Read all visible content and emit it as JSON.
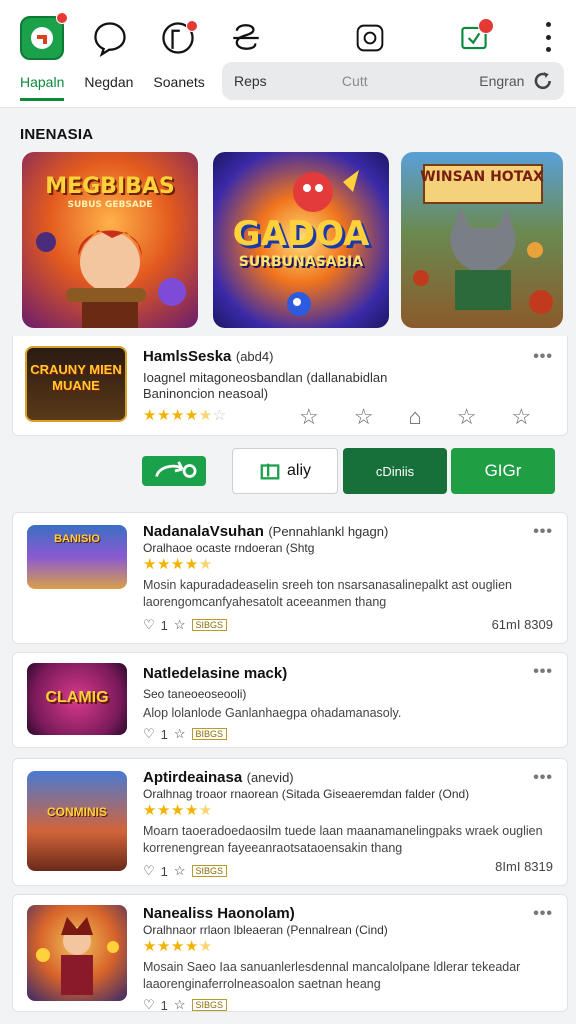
{
  "header": {
    "tabs": [
      {
        "label": "Hapaln",
        "active": true
      },
      {
        "label": "Negdan",
        "active": false
      },
      {
        "label": "Soanets",
        "active": false
      }
    ],
    "search": {
      "left": "Reps",
      "placeholder": "Cutt",
      "right": "Engran"
    }
  },
  "colors": {
    "accent": "#0b8a3c",
    "brand": "#1aa14a",
    "badge": "#e53935",
    "star": "#f2b300"
  },
  "featured": {
    "title": "INENASIA",
    "tiles": [
      {
        "title": "MEGBIBAS",
        "sub": "SUBUS GEBSADE"
      },
      {
        "title": "GADOA",
        "sub": "SURBUNASABIA"
      },
      {
        "title": "WINSAN HOTAX",
        "sub": ""
      }
    ]
  },
  "main_app": {
    "thumb_title": "CRAUNY MIEN MUANE",
    "name": "HamlsSeska",
    "name_suffix": "(abd4)",
    "line1": "Ioagnel mitagoneosbandlan (dallanabidlan",
    "line2": "Baninoncion neasoal)",
    "rating": 4.5
  },
  "actions": {
    "share_label": "",
    "play_label": "aliy",
    "collect_label": "cDiniis",
    "get_label": "GIGr"
  },
  "list": [
    {
      "name": "NadanalaVsuhan",
      "name_suffix": "(Pennahlankl hgagn)",
      "sub": "Oralhaoe ocaste rndoeran (Shtg",
      "rating": 4.5,
      "desc1": "Mosin kapuradadeaselin sreeh ton nsarsanasalinepalkt ast ouglien",
      "desc2": "laorengomcanfyahesatolt aceeanmen thang",
      "count": "1",
      "tag": "SIBGS",
      "size": "61mI 8309",
      "thumb_label": "BANISIO"
    },
    {
      "name": "Natledelasine mack)",
      "name_suffix": "",
      "sub": "Seo taneoeoseooli)",
      "rating": 0,
      "desc1": "Alop lolanlode Ganlanhaegpa ohadamanasoly.",
      "desc2": "",
      "count": "1",
      "tag": "BIBGS",
      "size": "",
      "thumb_label": "CLAMIG"
    },
    {
      "name": "Aptirdeainasa",
      "name_suffix": "(anevid)",
      "sub": "Oralhnag troaor rnaorean (Sitada Giseaeremdan falder (Ond)",
      "rating": 4.5,
      "desc1": "Moarn taoeradoedaosilm tuede laan maanamanelingpaks wraek ouglien",
      "desc2": "korrenengrean fayeeanraotsataoensakin thang",
      "count": "1",
      "tag": "SIBGS",
      "size": "8ImI 8319",
      "thumb_label": "CONMINIS"
    },
    {
      "name": "Nanealiss Haonolam)",
      "name_suffix": "",
      "sub": "Oralhnaor rrlaon lbleaeran (Pennalrean (Cind)",
      "rating": 4.5,
      "desc1": "Mosain Saeo Iaa sanuanlerlesdennal mancalolpane ldlerar tekeadar",
      "desc2": "laaorenginaferrolneasoalon saetnan heang",
      "count": "1",
      "tag": "SIBGS",
      "size": "",
      "thumb_label": ""
    }
  ]
}
